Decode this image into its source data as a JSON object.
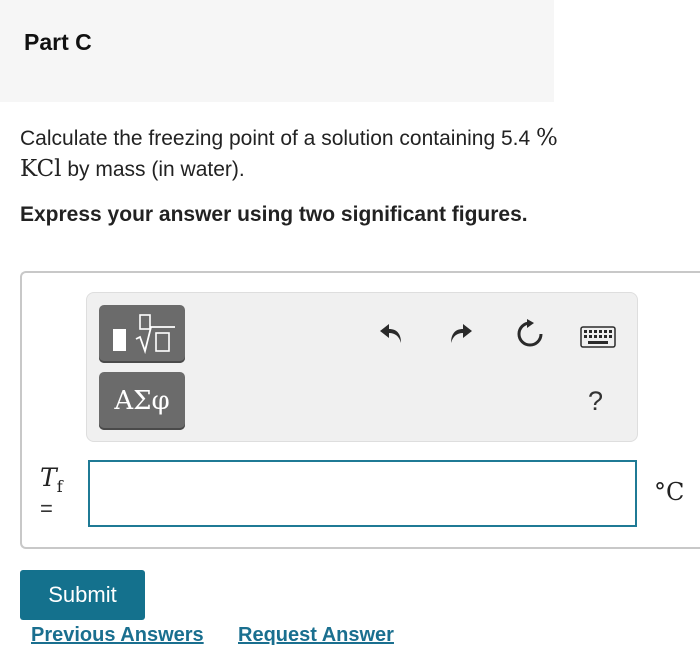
{
  "part": {
    "title": "Part C"
  },
  "question": {
    "text_before": "Calculate the freezing point of a solution containing 5.4 ",
    "percent": "%",
    "compound": "KCl",
    "text_after": " by mass (in water)."
  },
  "instruction": "Express your answer using two significant figures.",
  "toolbar": {
    "templates_icon": "templates-sqrt-icon",
    "symbols_label": "ΑΣφ",
    "undo_icon": "undo-icon",
    "redo_icon": "redo-icon",
    "reset_icon": "reset-icon",
    "keyboard_icon": "keyboard-icon",
    "help_label": "?"
  },
  "answer": {
    "variable": "T",
    "subscript": "f",
    "equals": "=",
    "value": "",
    "unit": "°C"
  },
  "actions": {
    "submit_label": "Submit",
    "previous_answers_label": "Previous Answers",
    "request_answer_label": "Request Answer"
  },
  "colors": {
    "accent": "#14718d",
    "link": "#1a6f8f",
    "button_gray": "#6b6b6b"
  }
}
